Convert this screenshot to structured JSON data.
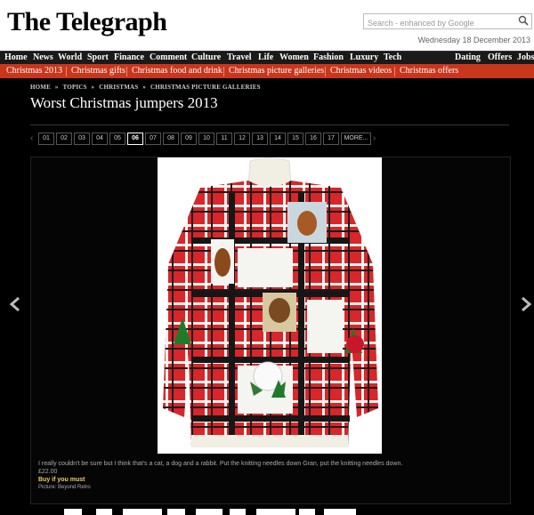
{
  "header": {
    "logo": "The Telegraph",
    "search_placeholder": "Search - enhanced by Google",
    "date": "Wednesday 18 December 2013"
  },
  "mainnav": {
    "items": [
      "Home",
      "News",
      "World",
      "Sport",
      "Finance",
      "Comment",
      "Culture",
      "Travel",
      "Life",
      "Women",
      "Fashion",
      "Luxury",
      "Tech"
    ],
    "right_items": [
      "Dating",
      "Offers",
      "Jobs"
    ]
  },
  "subnav": {
    "items": [
      "Christmas 2013",
      "Christmas gifts",
      "Christmas food and drink",
      "Christmas picture galleries",
      "Christmas videos",
      "Christmas offers"
    ]
  },
  "breadcrumb": [
    "HOME",
    "TOPICS",
    "CHRISTMAS",
    "CHRISTMAS PICTURE GALLERIES"
  ],
  "breadcrumb_sep": "»",
  "page_title": "Worst Christmas jumpers 2013",
  "pager": {
    "prev_symbol": "‹",
    "next_symbol": "›",
    "pages": [
      "01",
      "02",
      "03",
      "04",
      "05",
      "06",
      "07",
      "08",
      "09",
      "10",
      "11",
      "12",
      "13",
      "14",
      "15",
      "16",
      "17"
    ],
    "active_page": "06",
    "more_label": "MORE..."
  },
  "caption": {
    "text": "I really couldn't be sure but I think that's a cat, a dog and a rabbit. Put the knitting needles down Gran, put the knitting needles down.",
    "price": "£22.00",
    "buy_link": "Buy if you must",
    "credit": "Picture: Beyond Retro"
  },
  "colors": {
    "accent_red": "#c8361c",
    "nav_bg": "#1a1a1a",
    "buy_link": "#f0d060"
  }
}
